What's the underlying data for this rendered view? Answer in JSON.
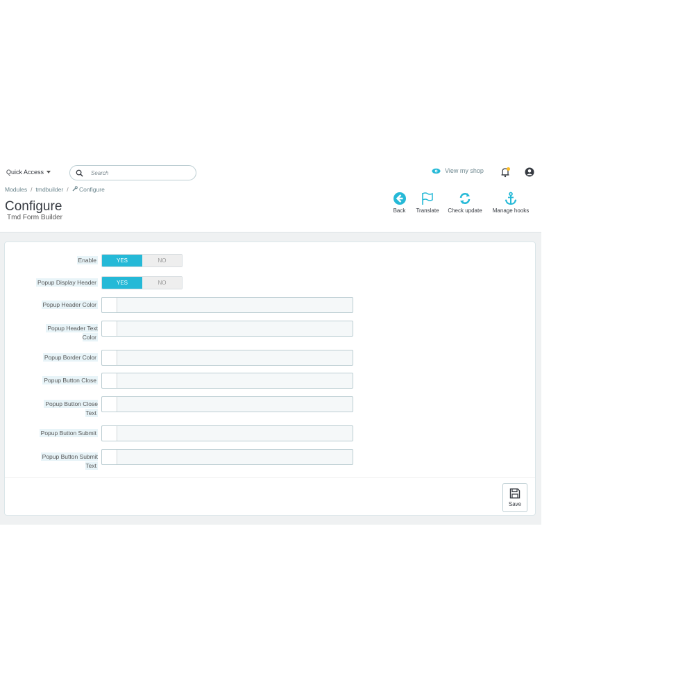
{
  "topbar": {
    "quick_access": "Quick Access",
    "search_placeholder": "Search",
    "view_shop": "View my shop"
  },
  "breadcrumb": [
    "Modules",
    "tmdbuilder",
    "Configure"
  ],
  "page": {
    "title": "Configure",
    "subtitle": "Tmd Form Builder"
  },
  "toolbar": {
    "back": "Back",
    "translate": "Translate",
    "check_update": "Check update",
    "manage_hooks": "Manage hooks"
  },
  "form": {
    "toggles": [
      {
        "label": "Enable",
        "yes": "YES",
        "no": "NO",
        "value": "YES"
      },
      {
        "label": "Popup Display Header",
        "yes": "YES",
        "no": "NO",
        "value": "YES"
      }
    ],
    "colors": [
      {
        "label": "Popup Header Color"
      },
      {
        "label": "Popup Header Text Color"
      },
      {
        "label": "Popup Border Color"
      },
      {
        "label": "Popup Button Close"
      },
      {
        "label": "Popup Button Close Text"
      },
      {
        "label": "Popup Button Submit"
      },
      {
        "label": "Popup Button Submit Text"
      }
    ]
  },
  "footer": {
    "save": "Save"
  },
  "colors": {
    "accent": "#25b9d7",
    "text": "#363a41"
  }
}
